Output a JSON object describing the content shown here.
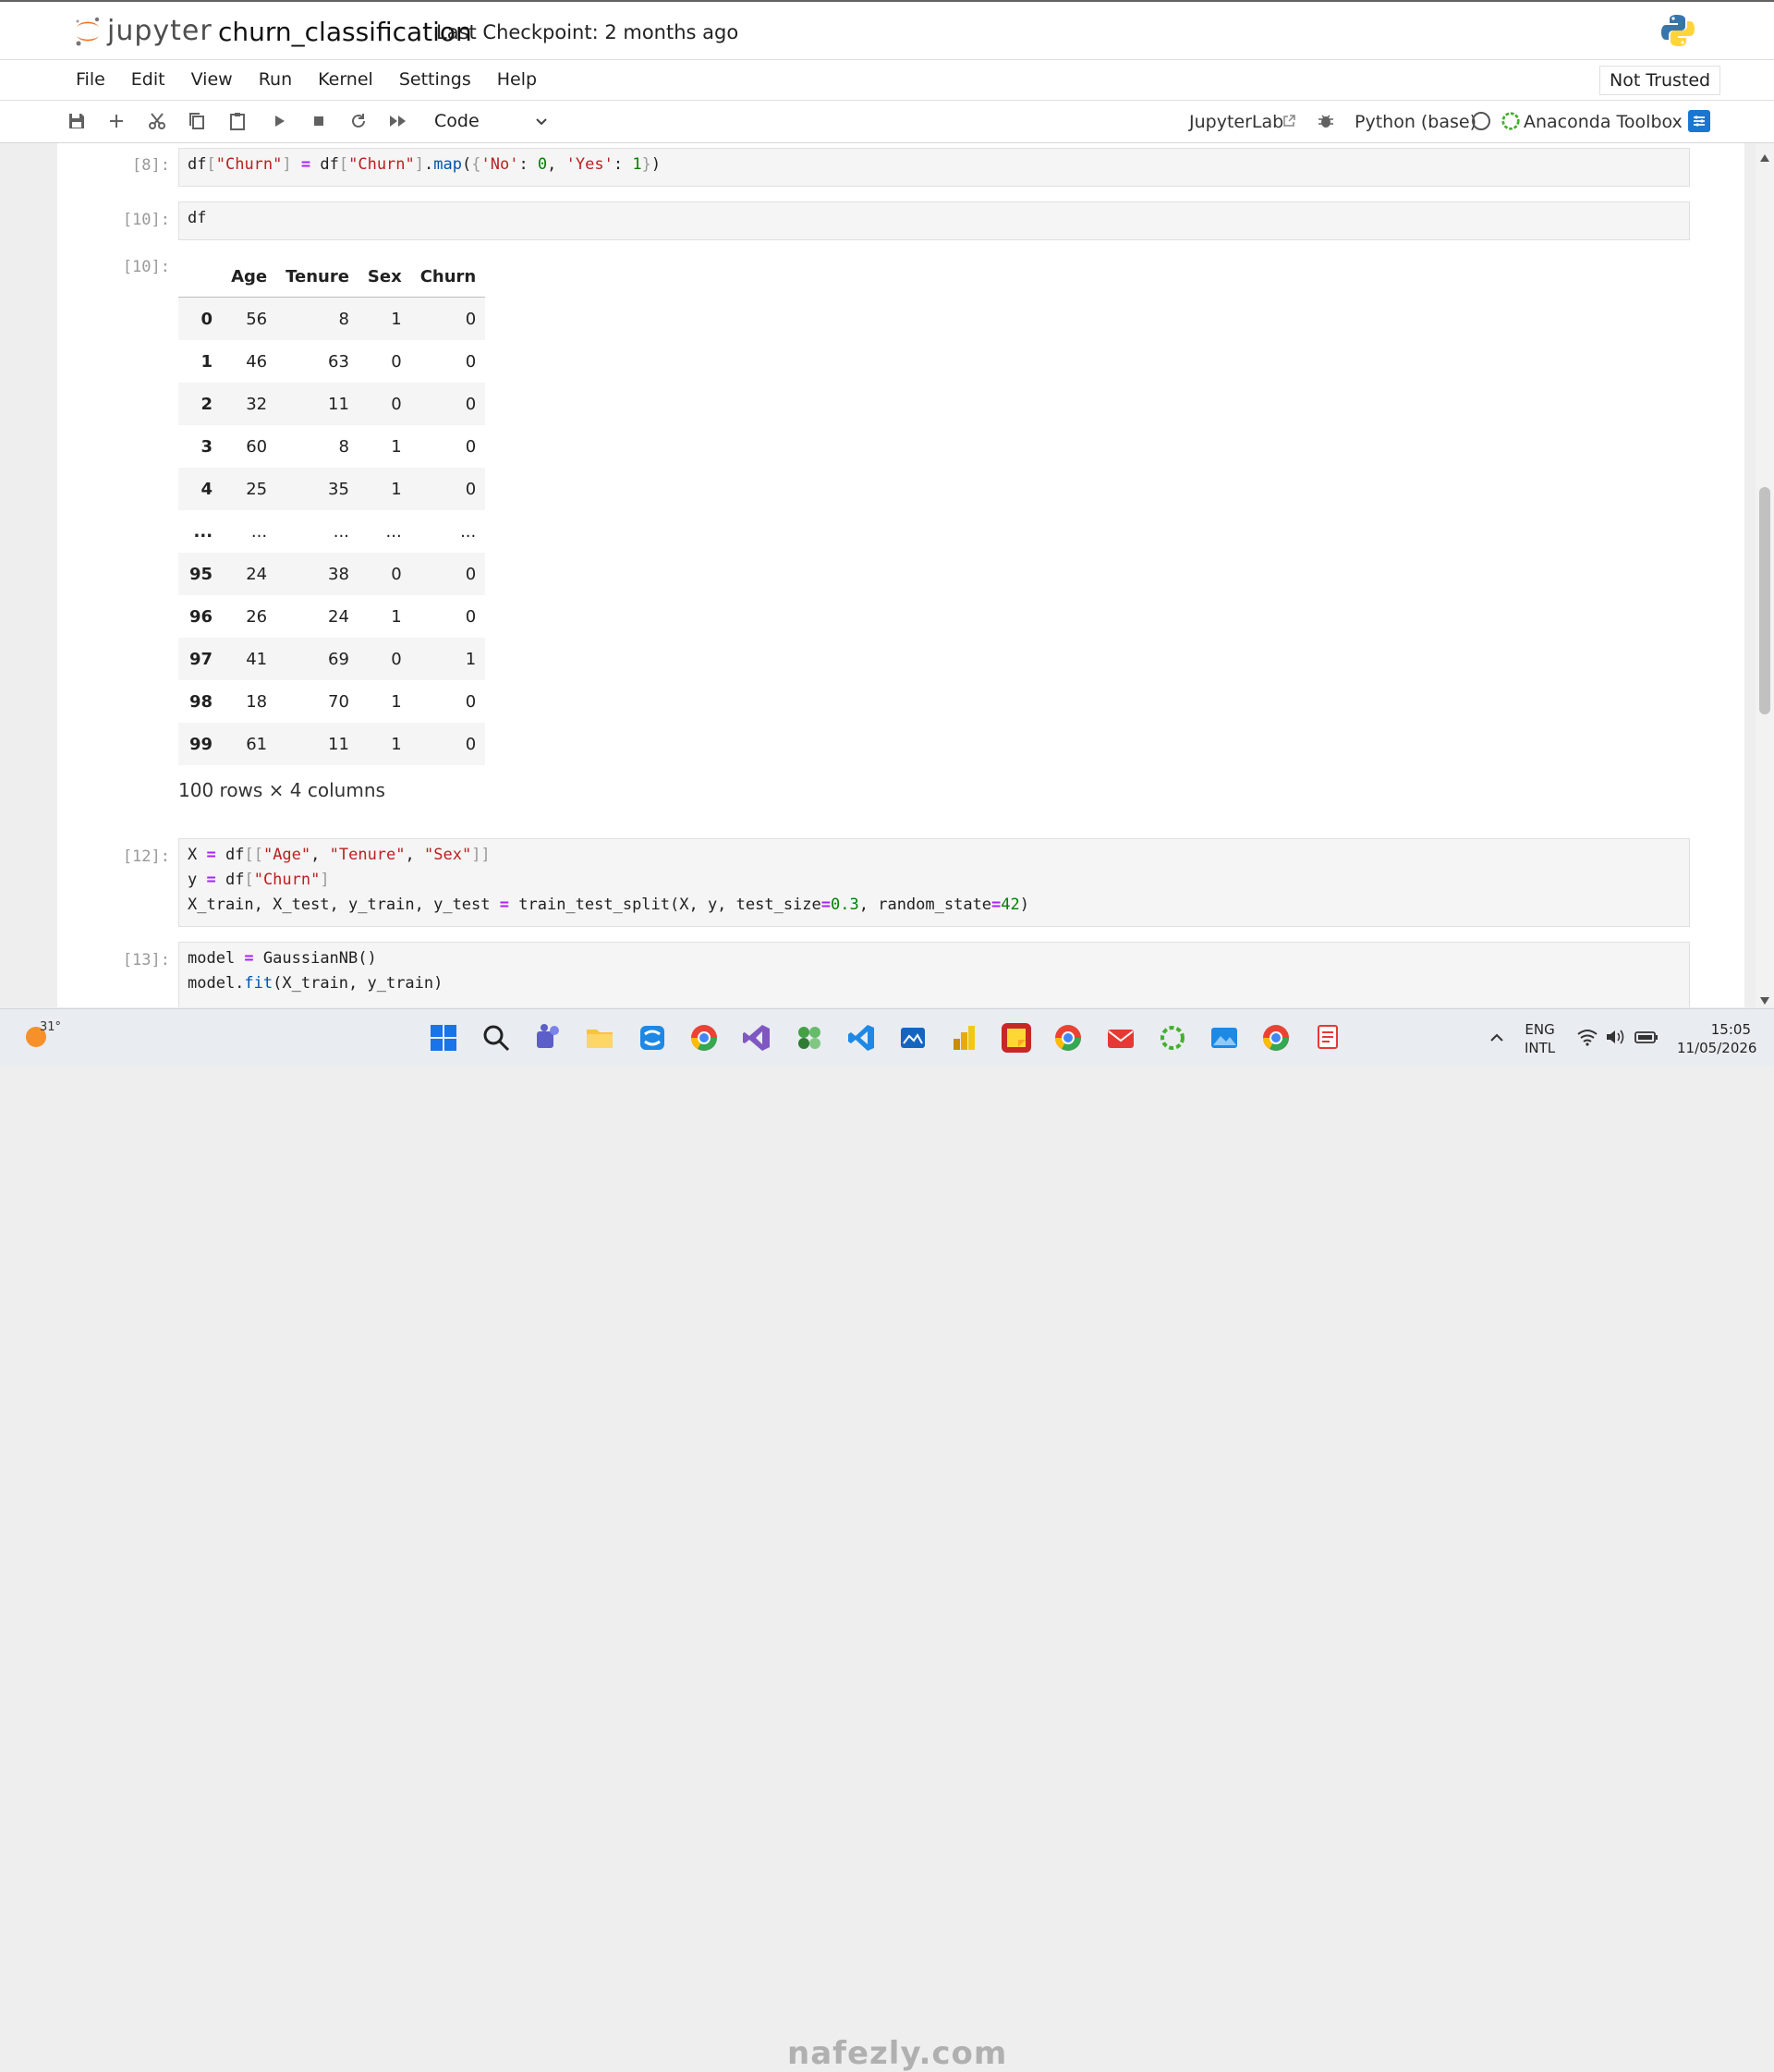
{
  "header": {
    "logo_text": "jupyter",
    "notebook_title": "churn_classification",
    "checkpoint": "Last Checkpoint: 2 months ago"
  },
  "menu": {
    "items": [
      "File",
      "Edit",
      "View",
      "Run",
      "Kernel",
      "Settings",
      "Help"
    ],
    "not_trusted": "Not Trusted"
  },
  "toolbar": {
    "cell_type": "Code",
    "jupyterlab": "JupyterLab",
    "kernel": "Python (base)",
    "anaconda": "Anaconda Toolbox"
  },
  "cells": {
    "c8": {
      "prompt": "[8]:"
    },
    "c10": {
      "prompt": "[10]:",
      "out_prompt": "[10]:"
    },
    "c12": {
      "prompt": "[12]:"
    },
    "c13": {
      "prompt": "[13]:"
    }
  },
  "dataframe": {
    "columns": [
      "Age",
      "Tenure",
      "Sex",
      "Churn"
    ],
    "rows": [
      {
        "index": "0",
        "values": [
          "56",
          "8",
          "1",
          "0"
        ]
      },
      {
        "index": "1",
        "values": [
          "46",
          "63",
          "0",
          "0"
        ]
      },
      {
        "index": "2",
        "values": [
          "32",
          "11",
          "0",
          "0"
        ]
      },
      {
        "index": "3",
        "values": [
          "60",
          "8",
          "1",
          "0"
        ]
      },
      {
        "index": "4",
        "values": [
          "25",
          "35",
          "1",
          "0"
        ]
      },
      {
        "index": "...",
        "values": [
          "...",
          "...",
          "...",
          "..."
        ]
      },
      {
        "index": "95",
        "values": [
          "24",
          "38",
          "0",
          "0"
        ]
      },
      {
        "index": "96",
        "values": [
          "26",
          "24",
          "1",
          "0"
        ]
      },
      {
        "index": "97",
        "values": [
          "41",
          "69",
          "0",
          "1"
        ]
      },
      {
        "index": "98",
        "values": [
          "18",
          "70",
          "1",
          "0"
        ]
      },
      {
        "index": "99",
        "values": [
          "61",
          "11",
          "1",
          "0"
        ]
      }
    ],
    "shape": "100 rows × 4 columns"
  },
  "taskbar": {
    "weather": "31°",
    "lang_line1": "ENG",
    "lang_line2": "INTL",
    "time": "15:05",
    "date": "11/05/2026",
    "watermark": "nafezly.com"
  }
}
